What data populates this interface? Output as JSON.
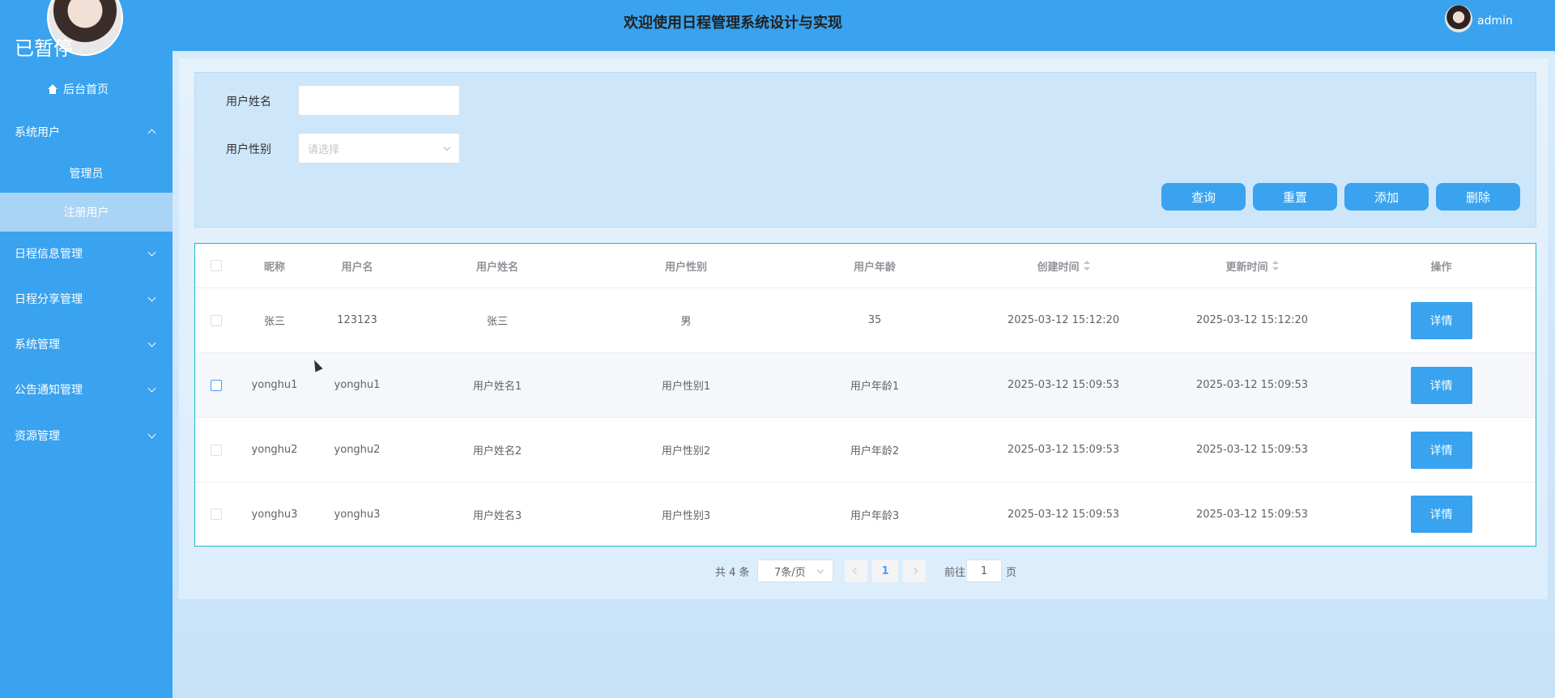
{
  "sidebar": {
    "brand": "已暂停",
    "home": "后台首页",
    "menus": [
      {
        "label": "系统用户",
        "expanded": true,
        "children": [
          {
            "label": "管理员",
            "active": false
          },
          {
            "label": "注册用户",
            "active": true
          }
        ]
      },
      {
        "label": "日程信息管理",
        "expanded": false
      },
      {
        "label": "日程分享管理",
        "expanded": false
      },
      {
        "label": "系统管理",
        "expanded": false
      },
      {
        "label": "公告通知管理",
        "expanded": false
      },
      {
        "label": "资源管理",
        "expanded": false
      }
    ]
  },
  "header": {
    "title": "欢迎使用日程管理系统设计与实现",
    "username": "admin"
  },
  "search": {
    "name_label": "用户姓名",
    "name_value": "",
    "gender_label": "用户性别",
    "gender_placeholder": "请选择",
    "buttons": {
      "query": "查询",
      "reset": "重置",
      "add": "添加",
      "delete": "删除"
    }
  },
  "table": {
    "columns": [
      "昵称",
      "用户名",
      "用户姓名",
      "用户性别",
      "用户年龄",
      "创建时间",
      "更新时间",
      "操作"
    ],
    "rows": [
      {
        "nickname": "张三",
        "username": "123123",
        "realname": "张三",
        "gender": "男",
        "age": "35",
        "created": "2025-03-12 15:12:20",
        "updated": "2025-03-12 15:12:20",
        "action": "详情"
      },
      {
        "nickname": "yonghu1",
        "username": "yonghu1",
        "realname": "用户姓名1",
        "gender": "用户性别1",
        "age": "用户年龄1",
        "created": "2025-03-12 15:09:53",
        "updated": "2025-03-12 15:09:53",
        "action": "详情"
      },
      {
        "nickname": "yonghu2",
        "username": "yonghu2",
        "realname": "用户姓名2",
        "gender": "用户性别2",
        "age": "用户年龄2",
        "created": "2025-03-12 15:09:53",
        "updated": "2025-03-12 15:09:53",
        "action": "详情"
      },
      {
        "nickname": "yonghu3",
        "username": "yonghu3",
        "realname": "用户姓名3",
        "gender": "用户性别3",
        "age": "用户年龄3",
        "created": "2025-03-12 15:09:53",
        "updated": "2025-03-12 15:09:53",
        "action": "详情"
      }
    ]
  },
  "pagination": {
    "total": "共 4 条",
    "page_size": "7条/页",
    "current_page": "1",
    "goto_prefix": "前往",
    "goto_value": "1",
    "goto_suffix": "页"
  },
  "colors": {
    "primary": "#39a3ef",
    "table_border": "#1fb7c6",
    "active_sub": "#a9d4f6"
  }
}
